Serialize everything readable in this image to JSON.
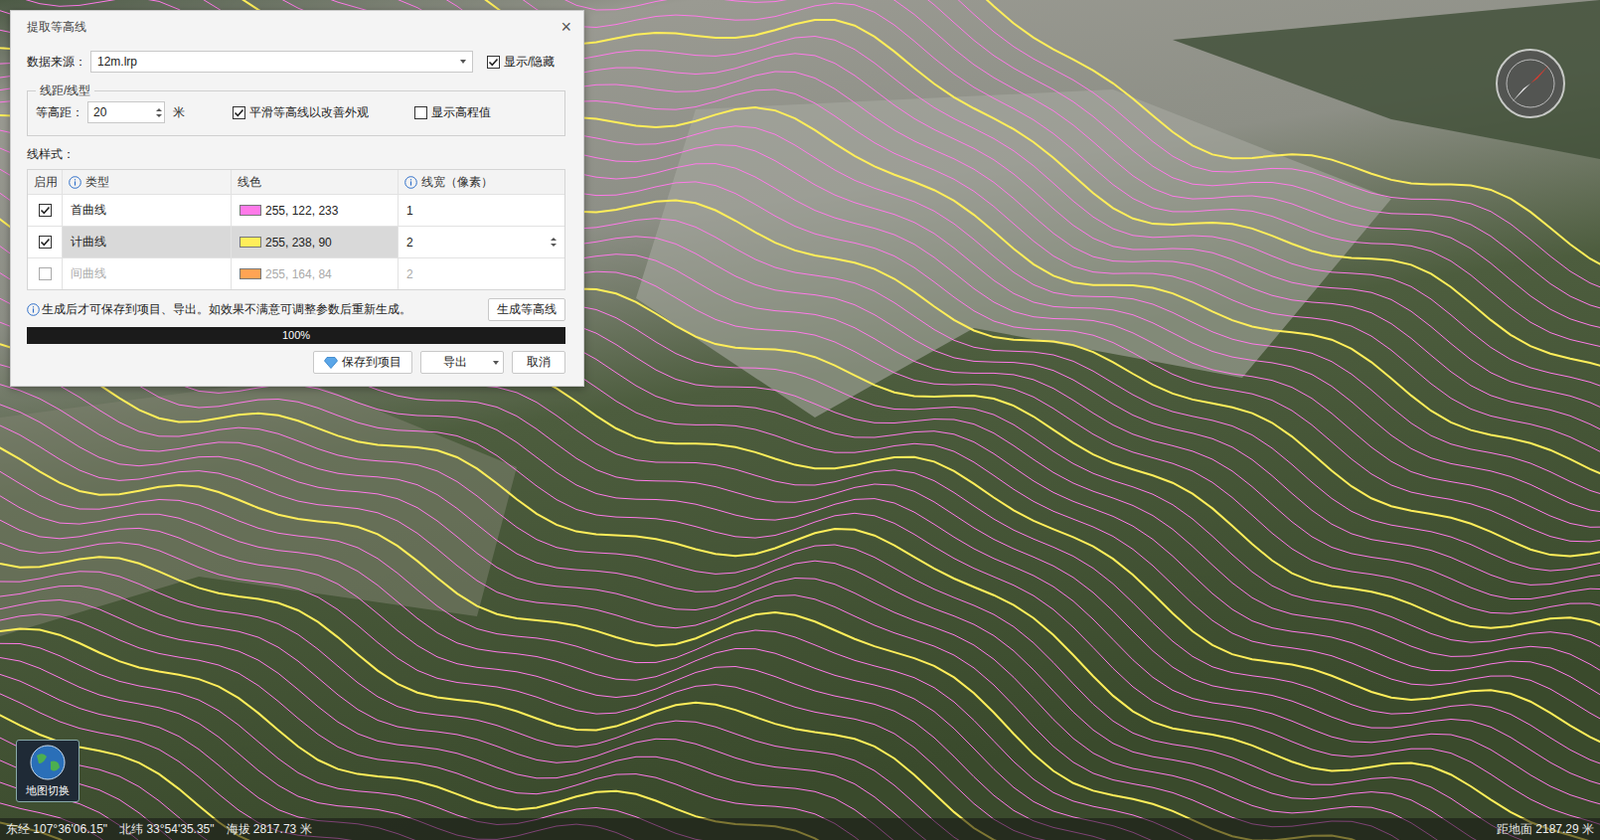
{
  "dialog": {
    "title": "提取等高线",
    "close": "×"
  },
  "source": {
    "label": "数据来源：",
    "value": "12m.lrp",
    "toggle": {
      "label": "显示/隐藏",
      "checked": true
    }
  },
  "spacing": {
    "group": "线距/线型",
    "label": "等高距：",
    "value": "20",
    "unit": "米",
    "smooth": {
      "label": "平滑等高线以改善外观",
      "checked": true
    },
    "elevation": {
      "label": "显示高程值",
      "checked": false
    }
  },
  "styles": {
    "label": "线样式：",
    "columns": [
      {
        "label": "启用",
        "info": false
      },
      {
        "label": "类型",
        "info": true
      },
      {
        "label": "线色",
        "info": false
      },
      {
        "label": "线宽（像素）",
        "info": true
      }
    ],
    "rows": [
      {
        "enabled": true,
        "type": "首曲线",
        "color": "#ff7ae9",
        "rgb": "255, 122, 233",
        "width": "1",
        "selected": false,
        "disabled": false
      },
      {
        "enabled": true,
        "type": "计曲线",
        "color": "#ffee5a",
        "rgb": "255, 238, 90",
        "width": "2",
        "selected": true,
        "disabled": false
      },
      {
        "enabled": false,
        "type": "间曲线",
        "color": "#ffa454",
        "rgb": "255, 164, 84",
        "width": "2",
        "selected": false,
        "disabled": true
      }
    ]
  },
  "hint": "生成后才可保存到项目、导出。如效果不满意可调整参数后重新生成。",
  "generate": "生成等高线",
  "progress": {
    "level": 1,
    "text": "100%"
  },
  "actions": [
    {
      "label": "保存到项目",
      "kind": "save"
    },
    {
      "label": "导出",
      "kind": "dropdown"
    },
    {
      "label": "取消",
      "kind": "plain"
    }
  ],
  "map": {
    "switch": "地图切换"
  },
  "status_bar": {
    "left": [
      "东经 107°36'06.15\"",
      "北纬 33°54'35.35\"",
      "海拔 2817.73 米"
    ],
    "right": "距地面 2187.29 米"
  }
}
